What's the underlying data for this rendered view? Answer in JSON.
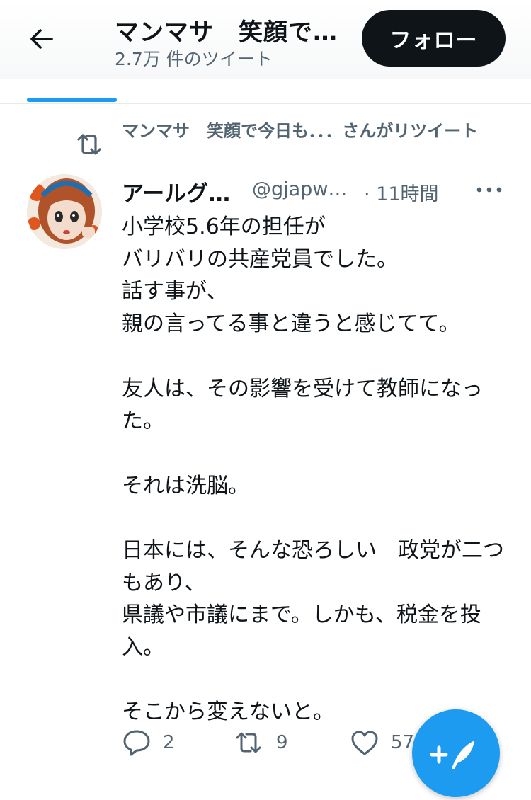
{
  "header": {
    "title": "マンマサ　笑顔で…",
    "tweet_count": "2.7万 件のツイート",
    "follow_label": "フォロー"
  },
  "retweet": {
    "text": "マンマサ　笑顔で今日も．．．さんがリツイート"
  },
  "tweet": {
    "author_name": "アールグ…",
    "handle": "@gjapw…",
    "time": "· 11時間",
    "paragraphs": [
      "小学校5.6年の担任が\nバリバリの共産党員でした。\n話す事が、\n親の言ってる事と違うと感じてて。",
      "友人は、その影響を受けて教師になった。",
      "それは洗脳。",
      "日本には、そんな恐ろしい　政党が二つもあり、\n県議や市議にまで。しかも、税金を投入。",
      "そこから変えないと。"
    ],
    "reply_count": "2",
    "retweet_count": "9",
    "like_count": "57"
  },
  "colors": {
    "accent": "#1d9bf0",
    "text_primary": "#0f1419",
    "text_secondary": "#536471",
    "follow_bg": "#0f1419"
  },
  "icons": {
    "back": "arrow-left-icon",
    "retweet": "retweet-icon",
    "more": "more-horizontal-icon",
    "reply": "comment-icon",
    "like": "heart-icon",
    "compose": "compose-feather-icon"
  }
}
